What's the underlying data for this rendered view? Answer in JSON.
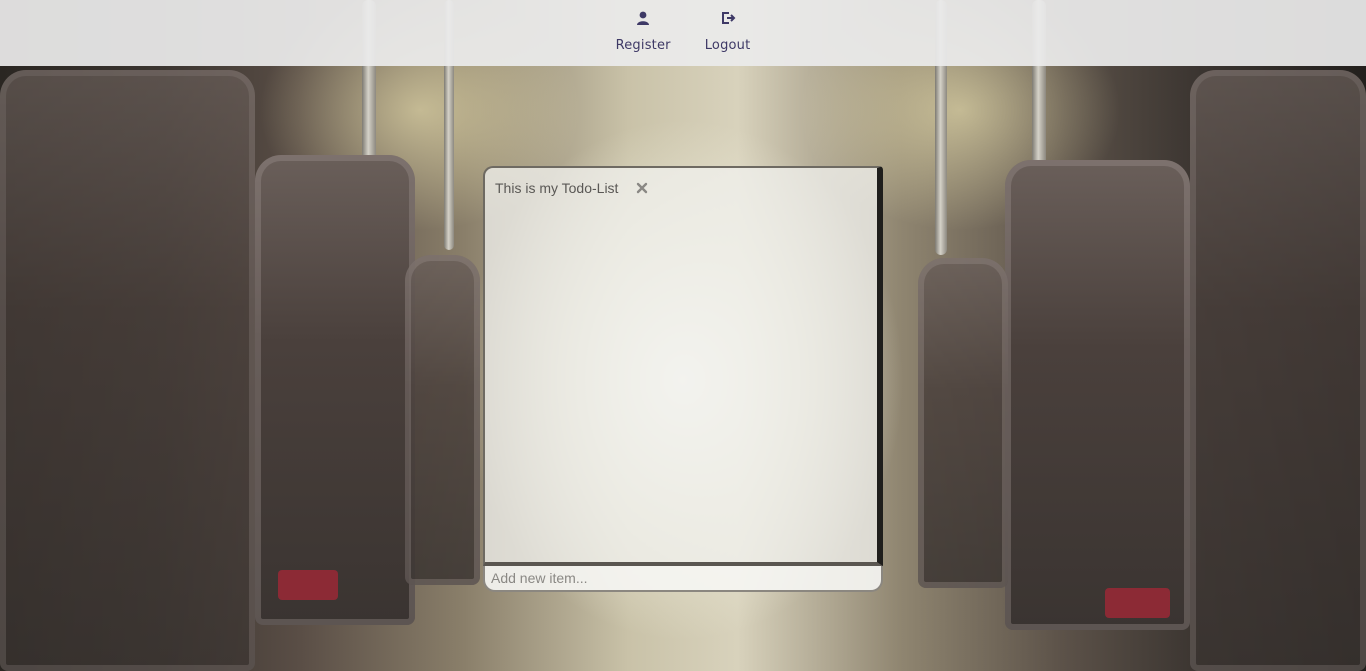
{
  "nav": {
    "items": [
      {
        "label": "Register",
        "icon": "user-icon"
      },
      {
        "label": "Logout",
        "icon": "logout-icon"
      }
    ],
    "color": "#3e3966"
  },
  "todo": {
    "title": "This is my Todo-List",
    "close_icon": "close-icon",
    "items": [],
    "new_item_placeholder": "Add new item...",
    "new_item_value": ""
  }
}
